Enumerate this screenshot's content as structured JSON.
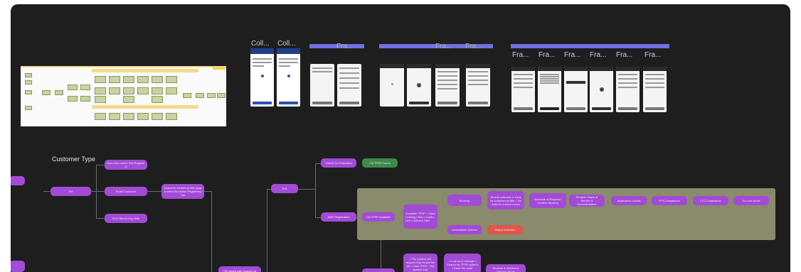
{
  "canvas": {
    "background": "#1e1e1e",
    "node_color": "#a24bd6",
    "green_color": "#3d8a4a",
    "red_color": "#e0564c",
    "section_color": "#7070e0"
  },
  "frames": {
    "coll_1": "Coll...",
    "coll_2": "Coll...",
    "fra_a": "Fra...",
    "fra_b": "Fra...",
    "fra_c": "Fra...",
    "fra_1": "Fra...",
    "fra_2": "Fra...",
    "fra_3": "Fra...",
    "fra_4": "Fra...",
    "fra_5": "Fra...",
    "fra_6": "Fra..."
  },
  "flow": {
    "customer_type_label": "Customer Type",
    "nodes": {
      "n_left_a": "",
      "n_top_1": "New User select Self Register in",
      "n_mid_1": "Ent",
      "n_mid_2": "Email Customer",
      "n_mid_3": "Customer created profile page & select Business Registering Tab",
      "n_bot_1": "Self Offered Key With",
      "n_ent": "Ent",
      "n_top_right_1": "Submit for Evaluation",
      "n_green": "LM TPSP Found",
      "n_sub": "SME Registration",
      "n_lm": "LM TPSP Available",
      "n_list": "Available TPSP: • Jaisa Leasing • NGI • Cubit • DHI • Cidesco Sam",
      "n_book": "Booking",
      "n_list2": "Should schedule & book by customer profile: • No slots for current Leave",
      "n_req": "Schedule of Request? Confirm Booking",
      "n_review": "Review Charts of Service & Documentation",
      "n_app": "Application Details",
      "n_fcs": "FPS Compliance",
      "n_ltc": "LTC Compliance",
      "n_end": "Go Live Email",
      "n_unavail": "Unavailable Options",
      "n_red": "Reject Selection",
      "n_bl1": "Tile based with request on",
      "n_bl2": "• The system will request that shows the vid • Click TPSP • The system may",
      "n_bl3": "• Look up & manage • Search for TPSP system • Enter the code",
      "n_bl4": "Receive & interest in Delivery Mode",
      "n_left_b": ""
    }
  }
}
